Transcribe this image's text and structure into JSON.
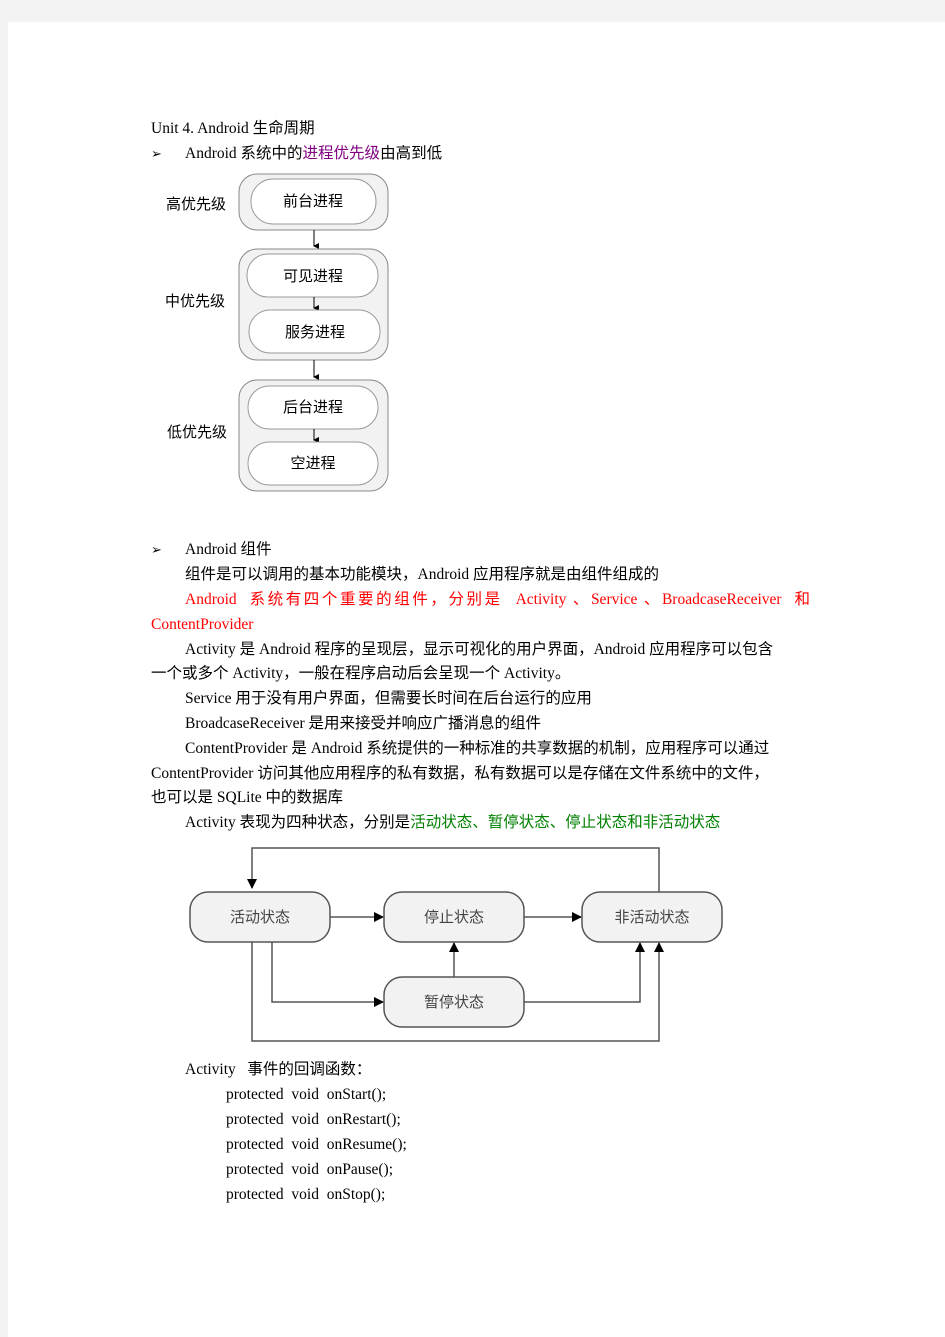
{
  "title": "Unit  4.  Android   生命周期",
  "section1": {
    "bullet": "➢",
    "heading_prefix": "Android 系统中的",
    "heading_highlight": "进程优先级",
    "heading_suffix": "由高到低",
    "diagram": {
      "levels": [
        {
          "label": "高优先级",
          "processes": [
            "前台进程"
          ]
        },
        {
          "label": "中优先级",
          "processes": [
            "可见进程",
            "服务进程"
          ]
        },
        {
          "label": "低优先级",
          "processes": [
            "后台进程",
            "空进程"
          ]
        }
      ]
    }
  },
  "section2": {
    "bullet": "➢",
    "heading": "Android 组件",
    "p1": "组件是可以调用的基本功能模块，Android 应用程序就是由组件组成的",
    "p2_line1": "Android  系统有四个重要的组件，分别是  Activity 、Service 、BroadcaseReceiver  和",
    "p2_line2": "ContentProvider",
    "p3_line1": "Activity 是 Android 程序的呈现层，显示可视化的用户界面，Android 应用程序可以包含",
    "p3_line2": "一个或多个 Activity，一般在程序启动后会呈现一个 Activity。",
    "p4": "Service 用于没有用户界面，但需要长时间在后台运行的应用",
    "p5": "BroadcaseReceiver 是用来接受并响应广播消息的组件",
    "p6_line1": "ContentProvider 是 Android 系统提供的一种标准的共享数据的机制，应用程序可以通过",
    "p6_line2": "ContentProvider 访问其他应用程序的私有数据，私有数据可以是存储在文件系统中的文件，",
    "p6_line3": "也可以是 SQLite 中的数据库",
    "p7_prefix": "Activity 表现为四种状态，分别是",
    "p7_highlight": "活动状态、暂停状态、停止状态和非活动状态"
  },
  "state_diagram": {
    "states": {
      "active": "活动状态",
      "stopped": "停止状态",
      "inactive": "非活动状态",
      "paused": "暂停状态"
    }
  },
  "callbacks": {
    "heading": "Activity   事件的回调函数：",
    "items": [
      "protected  void  onStart();",
      "protected  void  onRestart();",
      "protected  void  onResume();",
      "protected  void  onPause();",
      "protected  void  onStop();"
    ]
  },
  "colors": {
    "red": "#ff0000",
    "purple": "#800080",
    "green": "#008000",
    "box_fill": "#f2f2f2",
    "page_bg": "#f3f3f3"
  }
}
